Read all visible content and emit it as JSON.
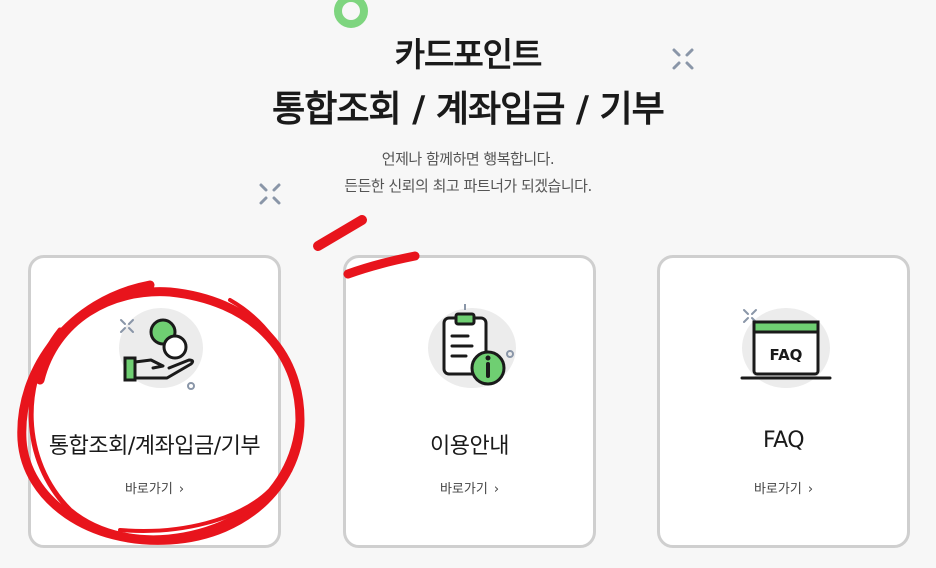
{
  "header": {
    "title_line1": "카드포인트",
    "title_line2": "통합조회 / 계좌입금 / 기부",
    "subtitle_line1": "언제나 함께하면 행복합니다.",
    "subtitle_line2": "든든한 신뢰의 최고 파트너가 되겠습니다."
  },
  "cards": [
    {
      "label": "통합조회/계좌입금/기부",
      "link": "바로가기",
      "icon": "hand-coins-icon"
    },
    {
      "label": "이용안내",
      "link": "바로가기",
      "icon": "clipboard-info-icon"
    },
    {
      "label": "FAQ",
      "link": "바로가기",
      "icon": "faq-screen-icon"
    }
  ],
  "chevron": "›",
  "colors": {
    "accent_green": "#7ed57f",
    "annotation_red": "#e8141c",
    "card_border": "#cfcfcf"
  }
}
